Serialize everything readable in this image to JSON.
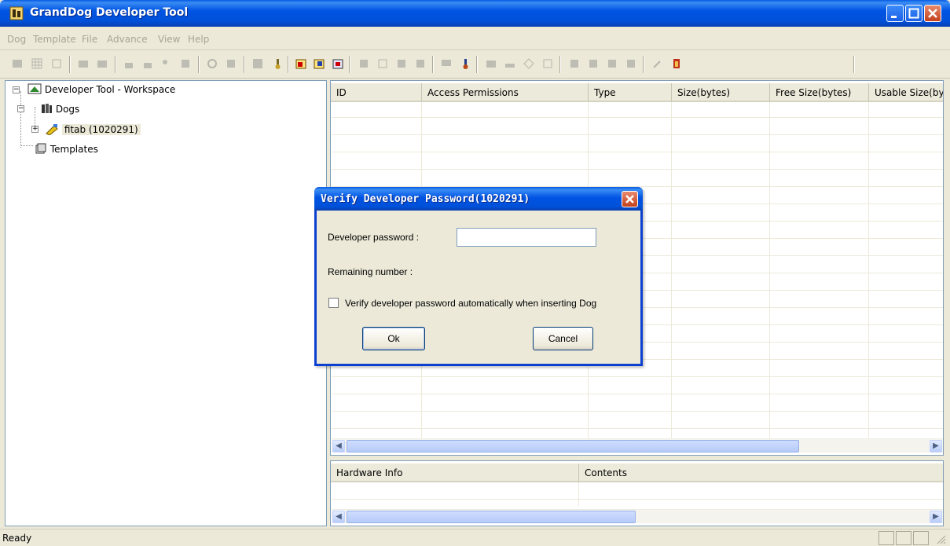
{
  "window": {
    "title": "GrandDog Developer Tool"
  },
  "menu": [
    "Dog",
    "Template",
    "File",
    "Advance",
    "View",
    "Help"
  ],
  "tree": {
    "root": "Developer Tool - Workspace",
    "dogs": "Dogs",
    "dog_item": "fitab (1020291)",
    "templates": "Templates"
  },
  "list": {
    "columns": [
      "ID",
      "Access Permissions",
      "Type",
      "Size(bytes)",
      "Free Size(bytes)",
      "Usable Size(by"
    ]
  },
  "bottom": {
    "columns": [
      "Hardware Info",
      "Contents"
    ]
  },
  "status": {
    "text": "Ready"
  },
  "dialog": {
    "title": "Verify Developer Password(1020291)",
    "password_label": "Developer password :",
    "password_value": "",
    "remaining_label": "Remaining number :",
    "auto_verify_label": "Verify developer password automatically when inserting Dog",
    "auto_verify_checked": false,
    "ok_label": "Ok",
    "cancel_label": "Cancel"
  },
  "colors": {
    "title_blue": "#0054e3",
    "dialog_border": "#0b40d0",
    "face": "#ece9d8",
    "disabled_text": "#a7a597"
  }
}
